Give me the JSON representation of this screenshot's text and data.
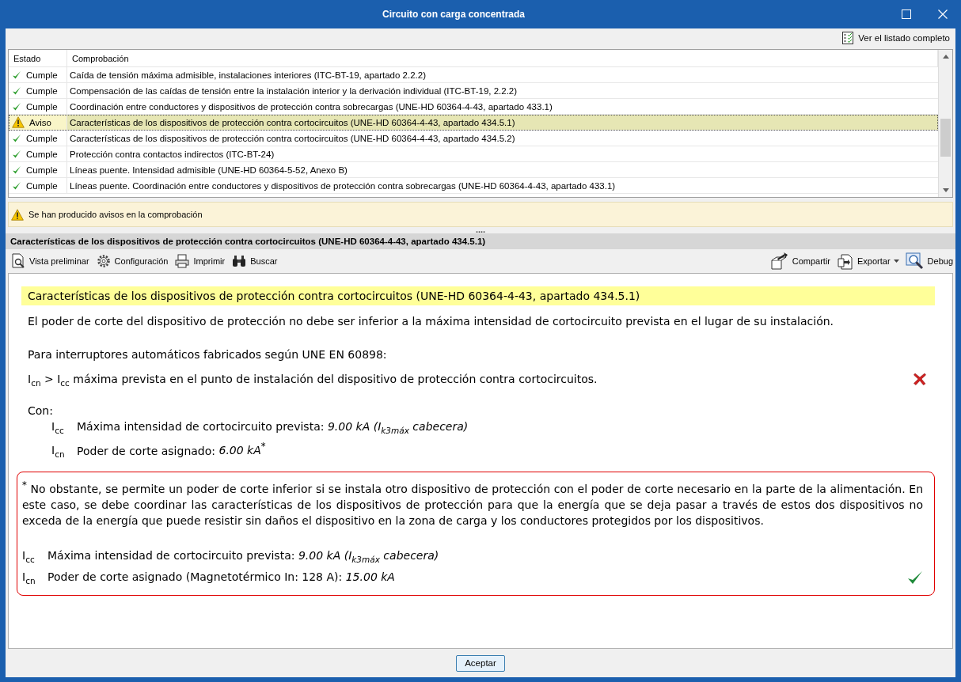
{
  "window": {
    "title": "Circuito con carga concentrada"
  },
  "top_toolbar": {
    "full_list_link": "Ver el listado completo"
  },
  "checks": {
    "columns": [
      "Estado",
      "Comprobación"
    ],
    "rows": [
      {
        "kind": "pass",
        "status": "Cumple",
        "check": "Caída de tensión máxima admisible, instalaciones interiores (ITC-BT-19, apartado 2.2.2)",
        "selected": false
      },
      {
        "kind": "pass",
        "status": "Cumple",
        "check": "Compensación de las caídas de tensión entre la instalación interior y la derivación individual (ITC-BT-19, 2.2.2)",
        "selected": false
      },
      {
        "kind": "pass",
        "status": "Cumple",
        "check": "Coordinación entre conductores y dispositivos de protección contra sobrecargas (UNE-HD 60364-4-43, apartado 433.1)",
        "selected": false
      },
      {
        "kind": "warning",
        "status": "Aviso",
        "check": "Características de los dispositivos de protección contra cortocircuitos (UNE-HD 60364-4-43, apartado 434.5.1)",
        "selected": true
      },
      {
        "kind": "pass",
        "status": "Cumple",
        "check": "Características de los dispositivos de protección contra cortocircuitos (UNE-HD 60364-4-43, apartado 434.5.2)",
        "selected": false
      },
      {
        "kind": "pass",
        "status": "Cumple",
        "check": "Protección contra contactos indirectos (ITC-BT-24)",
        "selected": false
      },
      {
        "kind": "pass",
        "status": "Cumple",
        "check": "Líneas puente. Intensidad admisible (UNE-HD 60364-5-52, Anexo B)",
        "selected": false
      },
      {
        "kind": "pass",
        "status": "Cumple",
        "check": "Líneas puente. Coordinación entre conductores y dispositivos de protección contra sobrecargas (UNE-HD 60364-4-43, apartado 433.1)",
        "selected": false
      }
    ]
  },
  "warning_bar": {
    "text": "Se han producido avisos en la comprobación"
  },
  "splitter": "....",
  "section_title": "Características de los dispositivos de protección contra cortocircuitos (UNE-HD 60364-4-43, apartado 434.5.1)",
  "report_toolbar": {
    "left": [
      {
        "kind": "preview",
        "label": "Vista preliminar"
      },
      {
        "kind": "settings",
        "label": "Configuración"
      },
      {
        "kind": "print",
        "label": "Imprimir"
      },
      {
        "kind": "binoculars",
        "label": "Buscar"
      }
    ],
    "right": [
      {
        "kind": "share",
        "label": "Compartir",
        "dropdown": false
      },
      {
        "kind": "export",
        "label": "Exportar",
        "dropdown": true
      },
      {
        "kind": "debug",
        "label": "Debug",
        "dropdown": false
      }
    ]
  },
  "report": {
    "heading": "Características de los dispositivos de protección contra cortocircuitos (UNE-HD 60364-4-43, apartado 434.5.1)",
    "intro": "El poder de corte del dispositivo de protección no debe ser inferior a la máxima intensidad de cortocircuito prevista en el lugar de su instalación.",
    "condition_title": "Para interruptores automáticos fabricados según UNE EN 60898:",
    "formula": {
      "text": "I$_{cn}$ > I$_{cc}$ máxima prevista en el punto de instalación del dispositivo de protección contra cortocircuitos.",
      "kind": "fail"
    },
    "with_label": "Con:",
    "definitions": [
      {
        "symbol": "I$_{cc}$",
        "label": "Máxima intensidad de cortocircuito prevista:",
        "value": "9.00 kA (I$_{k3máx}$ cabecera)"
      },
      {
        "symbol": "I$_{cn}$",
        "label": "Poder de corte asignado:",
        "value": "6.00 kA",
        "mark": "*"
      }
    ],
    "note": {
      "mark": "*",
      "text": "No obstante, se permite un poder de corte inferior si se instala otro dispositivo de protección con el poder de corte necesario en la parte de la alimentación. En este caso, se debe coordinar las características de los dispositivos de protección para que la energía que se deja pasar a través de estos dos dispositivos no exceda de la energía que puede resistir sin daños el dispositivo en la zona de carga y los conductores protegidos por los dispositivos.",
      "definitions": [
        {
          "symbol": "I$_{cc}$",
          "label": "Máxima intensidad de cortocircuito prevista:",
          "value": "9.00 kA (I$_{k3máx}$ cabecera)"
        },
        {
          "symbol": "I$_{cn}$",
          "label": "Poder de corte asignado (Magnetotérmico In: 128 A):",
          "value": "15.00 kA"
        }
      ],
      "kind": "pass"
    }
  },
  "footer": {
    "accept_button": "Aceptar"
  }
}
